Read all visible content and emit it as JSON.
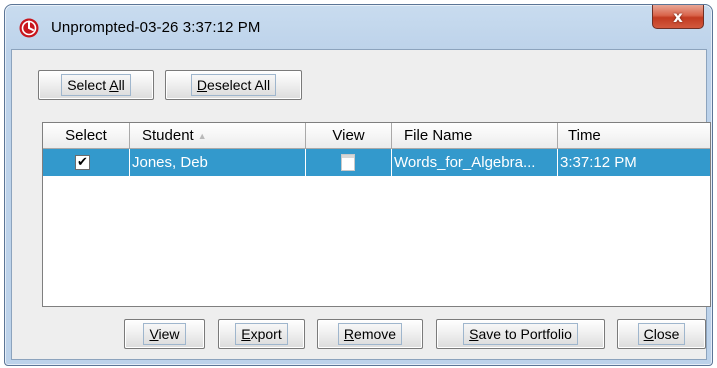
{
  "window": {
    "title": "Unprompted-03-26 3:37:12 PM",
    "close_glyph": "x"
  },
  "toolbar": {
    "select_all": {
      "pre": "Select ",
      "key": "A",
      "post": "ll"
    },
    "deselect_all": {
      "pre": "",
      "key": "D",
      "post": "eselect All"
    }
  },
  "table": {
    "columns": [
      "Select",
      "Student",
      "View",
      "File Name",
      "Time"
    ],
    "sort_indicator": "▲",
    "rows": [
      {
        "selected_glyph": "✔",
        "student": "Jones, Deb",
        "file_name": "Words_for_Algebra...",
        "time": "3:37:12 PM"
      }
    ]
  },
  "buttons": {
    "view": {
      "pre": "",
      "key": "V",
      "post": "iew"
    },
    "export": {
      "pre": "",
      "key": "E",
      "post": "xport"
    },
    "remove": {
      "pre": "",
      "key": "R",
      "post": "emove"
    },
    "save_to_portfolio": {
      "pre": "",
      "key": "S",
      "post": "ave to Portfolio"
    },
    "close": {
      "pre": "",
      "key": "C",
      "post": "lose"
    }
  },
  "colors": {
    "selection": "#3399cc",
    "close_button": "#c23b21",
    "app_icon": "#c8161d"
  },
  "icons": [
    "app-logo-icon",
    "close-icon",
    "checkbox-checked-icon",
    "document-icon",
    "sort-ascending-icon"
  ]
}
